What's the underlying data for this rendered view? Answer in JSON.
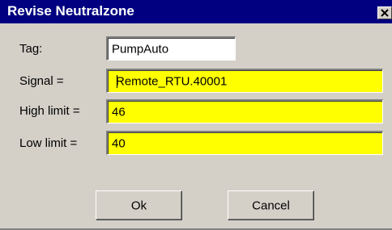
{
  "window": {
    "title": "Revise Neutralzone",
    "close_icon": "close-icon"
  },
  "form": {
    "tag": {
      "label": "Tag:",
      "value": "PumpAuto",
      "background": "#ffffff"
    },
    "signal": {
      "label": "Signal =",
      "value": "Remote_RTU.40001",
      "background": "#ffff00"
    },
    "high_limit": {
      "label": "High limit =",
      "value": "46",
      "background": "#ffff00"
    },
    "low_limit": {
      "label": "Low limit =",
      "value": "40",
      "background": "#ffff00"
    }
  },
  "buttons": {
    "ok_label": "Ok",
    "cancel_label": "Cancel"
  },
  "colors": {
    "title_bar": "#000080",
    "face": "#d4d0c8",
    "highlight_field": "#ffff00"
  }
}
